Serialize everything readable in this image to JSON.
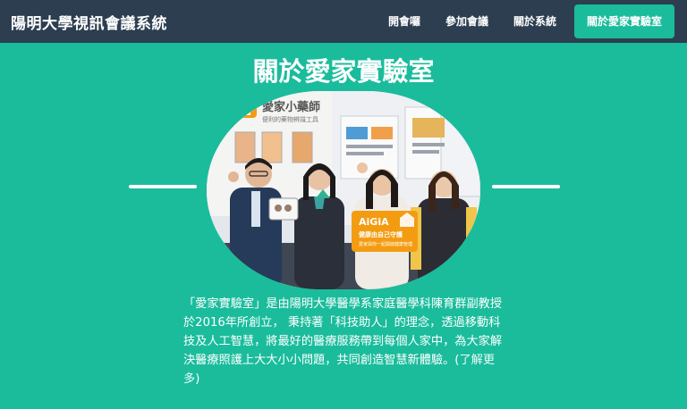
{
  "navbar": {
    "brand": "陽明大學視訊會議系統",
    "items": [
      {
        "label": "開會囉"
      },
      {
        "label": "參加會議"
      },
      {
        "label": "關於系統"
      },
      {
        "label": "關於愛家實驗室"
      }
    ],
    "active_index": 3
  },
  "section": {
    "title": "關於愛家實驗室"
  },
  "photo": {
    "sign_title": "愛家小藥師",
    "sign_subtitle": "便利的藥物辨識工具",
    "card_brand": "AiGiA",
    "card_line1": "健康由自己守護",
    "card_line2": "愛家與你一起開啟健康管理"
  },
  "description": {
    "text": "「愛家實驗室」是由陽明大學醫學系家庭醫學科陳育群副教授於2016年所創立， 秉持著「科技助人」的理念，透過移動科技及人工智慧，將最好的醫療服務帶到每個人家中，為大家解決醫療照護上大大小小問題，共同創造智慧新體驗。(",
    "more_link": "了解更多",
    "close_paren": ")"
  },
  "colors": {
    "navbar_bg": "#2c3e50",
    "accent": "#1abc9c",
    "card_orange": "#f39c12"
  }
}
